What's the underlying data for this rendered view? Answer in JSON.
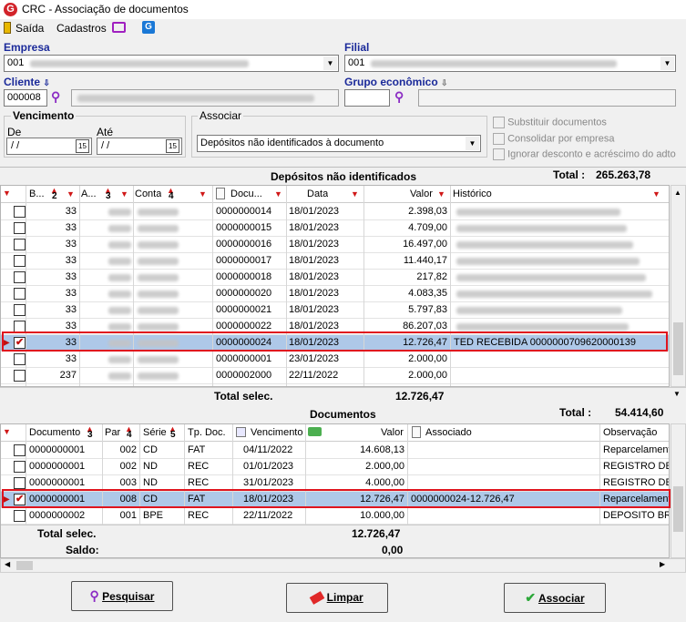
{
  "window": {
    "title": "CRC - Associação de documentos"
  },
  "menu": {
    "saida": "Saída",
    "cadastros": "Cadastros"
  },
  "header": {
    "empresa_label": "Empresa",
    "empresa_value": "001",
    "filial_label": "Filial",
    "filial_value": "001",
    "cliente_label": "Cliente",
    "cliente_value": "000008",
    "grupo_label": "Grupo econômico"
  },
  "vencimento": {
    "label": "Vencimento",
    "de_label": "De",
    "ate_label": "Até",
    "de_value": " / /",
    "ate_value": " / /"
  },
  "associar": {
    "label": "Associar",
    "value": "Depósitos não identificados à documento"
  },
  "options": {
    "substituir": "Substituir documentos",
    "consolidar": "Consolidar por empresa",
    "ignorar": "Ignorar desconto e acréscimo do adto"
  },
  "depositos": {
    "title": "Depósitos não identificados",
    "total_label": "Total :",
    "total_value": "265.263,78",
    "columns": {
      "b": "B...",
      "a": "A...",
      "conta": "Conta",
      "documento": "Docu...",
      "data": "Data",
      "valor": "Valor",
      "historico": "Histórico"
    },
    "sort": {
      "b": "2",
      "a": "3",
      "conta": "4"
    },
    "rows": [
      {
        "checked": false,
        "b": "33",
        "doc": "0000000014",
        "data": "18/01/2023",
        "valor": "2.398,03",
        "hist": ""
      },
      {
        "checked": false,
        "b": "33",
        "doc": "0000000015",
        "data": "18/01/2023",
        "valor": "4.709,00",
        "hist": ""
      },
      {
        "checked": false,
        "b": "33",
        "doc": "0000000016",
        "data": "18/01/2023",
        "valor": "16.497,00",
        "hist": ""
      },
      {
        "checked": false,
        "b": "33",
        "doc": "0000000017",
        "data": "18/01/2023",
        "valor": "11.440,17",
        "hist": ""
      },
      {
        "checked": false,
        "b": "33",
        "doc": "0000000018",
        "data": "18/01/2023",
        "valor": "217,82",
        "hist": ""
      },
      {
        "checked": false,
        "b": "33",
        "doc": "0000000020",
        "data": "18/01/2023",
        "valor": "4.083,35",
        "hist": ""
      },
      {
        "checked": false,
        "b": "33",
        "doc": "0000000021",
        "data": "18/01/2023",
        "valor": "5.797,83",
        "hist": ""
      },
      {
        "checked": false,
        "b": "33",
        "doc": "0000000022",
        "data": "18/01/2023",
        "valor": "86.207,03",
        "hist": ""
      },
      {
        "checked": true,
        "b": "33",
        "doc": "0000000024",
        "data": "18/01/2023",
        "valor": "12.726,47",
        "hist": "TED RECEBIDA  0000000709620000139"
      },
      {
        "checked": false,
        "b": "33",
        "doc": "0000000001",
        "data": "23/01/2023",
        "valor": "2.000,00",
        "hist": ""
      },
      {
        "checked": false,
        "b": "237",
        "doc": "0000002000",
        "data": "22/11/2022",
        "valor": "2.000,00",
        "hist": ""
      }
    ],
    "total_selec_label": "Total selec.",
    "total_selec_value": "12.726,47"
  },
  "documentos": {
    "title": "Documentos",
    "total_label": "Total :",
    "total_value": "54.414,60",
    "columns": {
      "documento": "Documento",
      "par": "Par",
      "serie": "Série",
      "tpdoc": "Tp. Doc.",
      "vencimento": "Vencimento",
      "valor": "Valor",
      "associado": "Associado",
      "obs": "Observação"
    },
    "sort": {
      "documento": "3",
      "par": "4",
      "serie": "5"
    },
    "rows": [
      {
        "checked": false,
        "doc": "0000000001",
        "par": "002",
        "serie": "CD",
        "tp": "FAT",
        "venc": "04/11/2022",
        "valor": "14.608,13",
        "assoc": "",
        "obs": "Reparcelament"
      },
      {
        "checked": false,
        "doc": "0000000001",
        "par": "002",
        "serie": "ND",
        "tp": "REC",
        "venc": "01/01/2023",
        "valor": "2.000,00",
        "assoc": "",
        "obs": "REGISTRO DE"
      },
      {
        "checked": false,
        "doc": "0000000001",
        "par": "003",
        "serie": "ND",
        "tp": "REC",
        "venc": "31/01/2023",
        "valor": "4.000,00",
        "assoc": "",
        "obs": "REGISTRO DE"
      },
      {
        "checked": true,
        "doc": "0000000001",
        "par": "008",
        "serie": "CD",
        "tp": "FAT",
        "venc": "18/01/2023",
        "valor": "12.726,47",
        "assoc": "0000000024-12.726,47",
        "obs": "Reparcelament"
      },
      {
        "checked": false,
        "doc": "0000000002",
        "par": "001",
        "serie": "BPE",
        "tp": "REC",
        "venc": "22/11/2022",
        "valor": "10.000,00",
        "assoc": "",
        "obs": "DEPOSITO BR"
      }
    ],
    "total_selec_label": "Total selec.",
    "total_selec_value": "12.726,47",
    "saldo_label": "Saldo:",
    "saldo_value": "0,00"
  },
  "buttons": {
    "pesquisar": "Pesquisar",
    "limpar": "Limpar",
    "associar": "Associar"
  },
  "colors": {
    "accent": "#1b2a9a",
    "highlight": "#e0141e",
    "selected_row": "#aec8e8"
  }
}
